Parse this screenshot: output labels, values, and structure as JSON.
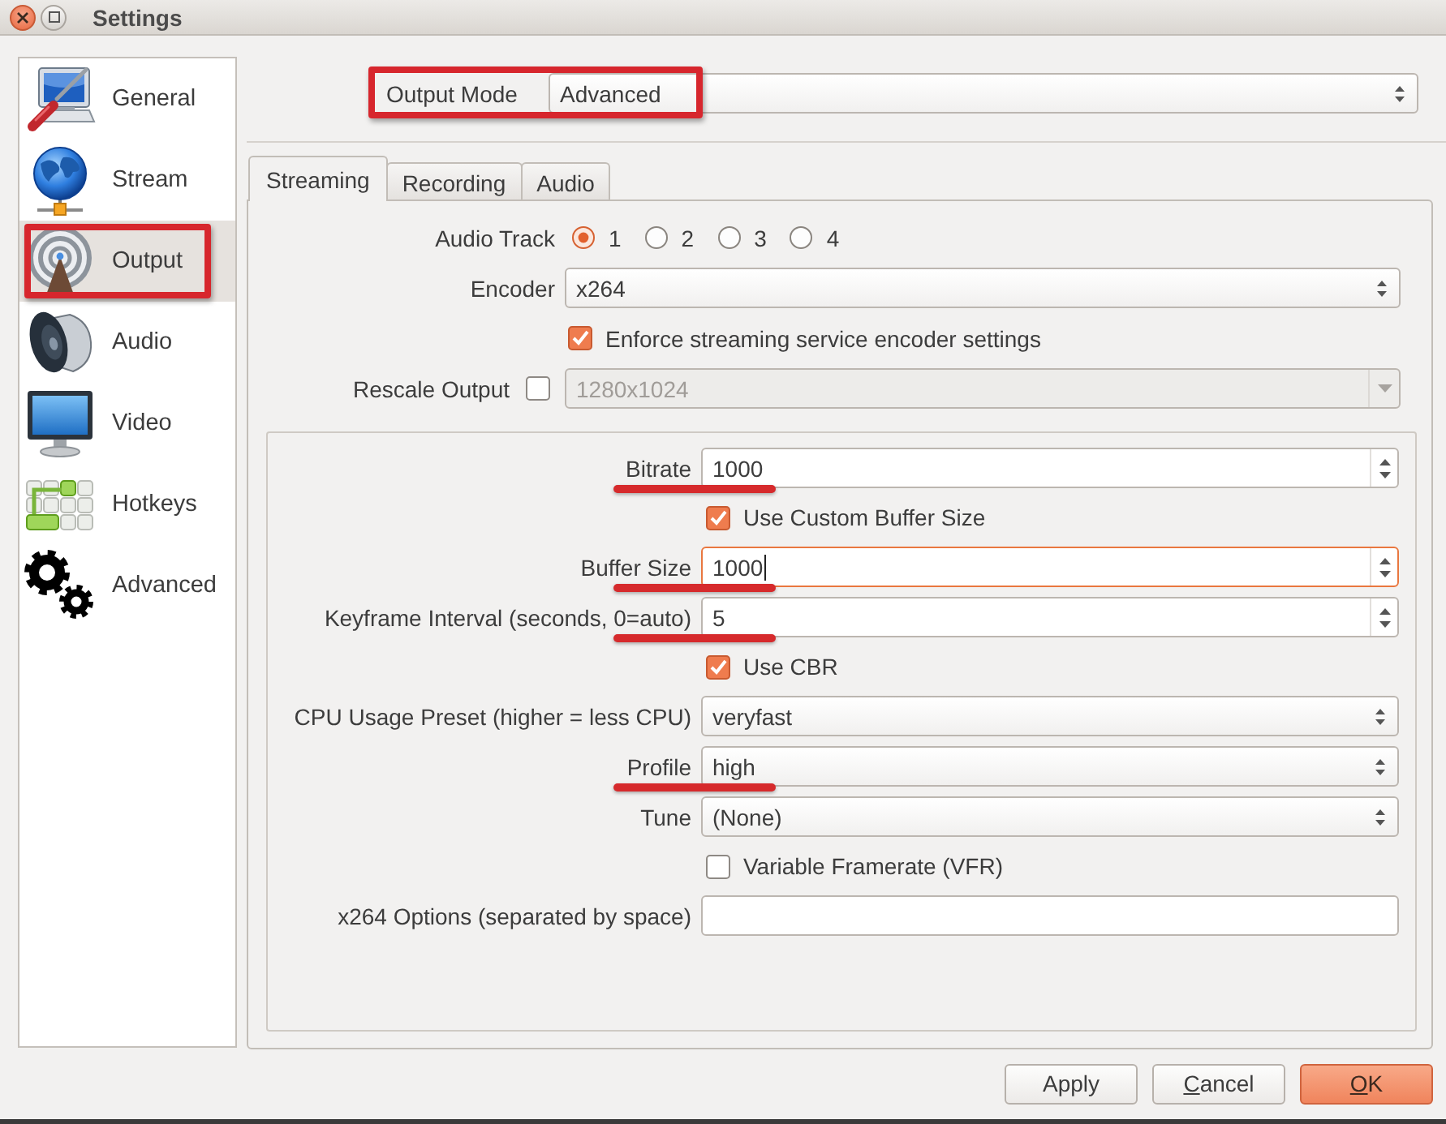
{
  "window": {
    "title": "Settings"
  },
  "sidebar": {
    "items": [
      {
        "label": "General",
        "selected": false,
        "annotated": false
      },
      {
        "label": "Stream",
        "selected": false,
        "annotated": false
      },
      {
        "label": "Output",
        "selected": true,
        "annotated": true
      },
      {
        "label": "Audio",
        "selected": false,
        "annotated": false
      },
      {
        "label": "Video",
        "selected": false,
        "annotated": false
      },
      {
        "label": "Hotkeys",
        "selected": false,
        "annotated": false
      },
      {
        "label": "Advanced",
        "selected": false,
        "annotated": false
      }
    ]
  },
  "output_mode": {
    "label": "Output Mode",
    "value": "Advanced",
    "annotated": true
  },
  "tabs": [
    {
      "label": "Streaming",
      "selected": true
    },
    {
      "label": "Recording",
      "selected": false
    },
    {
      "label": "Audio",
      "selected": false
    }
  ],
  "streaming_tab": {
    "rows": [
      {
        "kind": "radios",
        "label": "Audio Track",
        "disabled": false,
        "options": [
          {
            "label": "1",
            "selected": true
          },
          {
            "label": "2",
            "selected": false
          },
          {
            "label": "3",
            "selected": false
          },
          {
            "label": "4",
            "selected": false
          }
        ]
      },
      {
        "kind": "combo",
        "label": "Encoder",
        "value": "x264",
        "disabled": false
      },
      {
        "kind": "check",
        "label": "Enforce streaming service encoder settings",
        "checked": true,
        "disabled": false
      },
      {
        "kind": "check-combo",
        "label": "Rescale Output",
        "checked": false,
        "value": "1280x1024",
        "disabled": true
      }
    ],
    "encoder_settings": {
      "rows": [
        {
          "kind": "spin",
          "label": "Bitrate",
          "value": "1000",
          "focused": false,
          "annotated": true
        },
        {
          "kind": "check",
          "label": "Use Custom Buffer Size",
          "checked": true,
          "annotated": false
        },
        {
          "kind": "spin",
          "label": "Buffer Size",
          "value": "1000",
          "focused": true,
          "annotated": true
        },
        {
          "kind": "spin",
          "label": "Keyframe Interval (seconds, 0=auto)",
          "value": "5",
          "focused": false,
          "annotated": true
        },
        {
          "kind": "check",
          "label": "Use CBR",
          "checked": true,
          "annotated": false
        },
        {
          "kind": "combo",
          "label": "CPU Usage Preset (higher = less CPU)",
          "value": "veryfast",
          "focused": false,
          "annotated": false
        },
        {
          "kind": "combo",
          "label": "Profile",
          "value": "high",
          "focused": false,
          "annotated": true
        },
        {
          "kind": "combo",
          "label": "Tune",
          "value": "(None)",
          "focused": false,
          "annotated": false
        },
        {
          "kind": "check",
          "label": "Variable Framerate (VFR)",
          "checked": false,
          "annotated": false
        },
        {
          "kind": "text",
          "label": "x264 Options (separated by space)",
          "focused": false,
          "annotated": false
        }
      ]
    }
  },
  "buttons": [
    {
      "label": "Apply",
      "default": false,
      "mnemonic": false
    },
    {
      "label": "Cancel",
      "default": false,
      "mnemonic": true
    },
    {
      "label": "OK",
      "default": true,
      "mnemonic": true
    }
  ]
}
